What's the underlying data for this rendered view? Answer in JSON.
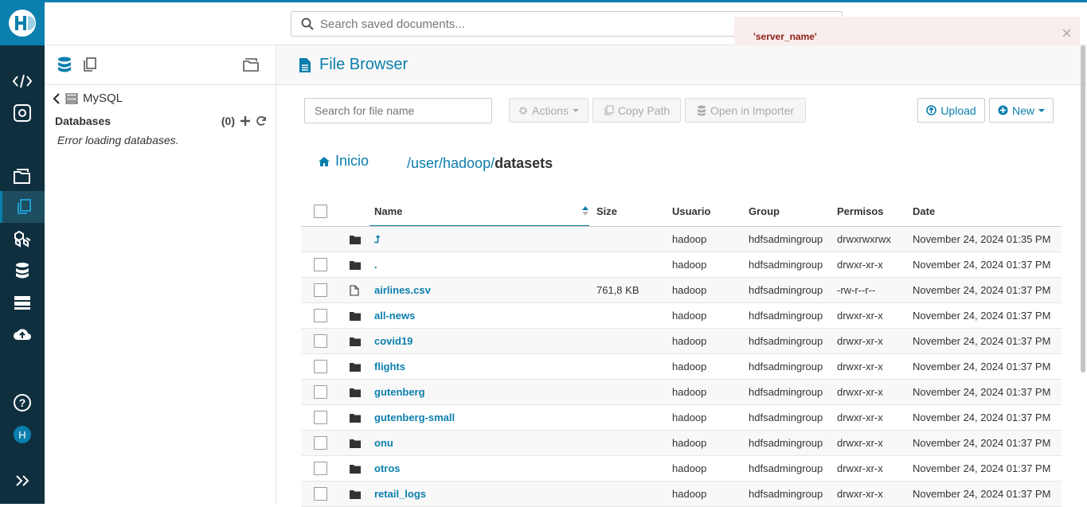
{
  "search": {
    "placeholder": "Search saved documents..."
  },
  "toast": {
    "message": "'server_name'",
    "close": "×"
  },
  "leftpanel": {
    "back_label": "MySQL",
    "databases_label": "Databases",
    "count": "(0)",
    "error": "Error loading databases."
  },
  "main": {
    "title": "File Browser",
    "filter_placeholder": "Search for file name",
    "actions_label": "Actions",
    "copy_label": "Copy Path",
    "importer_label": "Open in Importer",
    "upload_label": "Upload",
    "new_label": "New",
    "home_label": "Inicio",
    "path_prefix": "/user/hadoop/",
    "path_current": "datasets"
  },
  "table": {
    "headers": {
      "name": "Name",
      "size": "Size",
      "user": "Usuario",
      "group": "Group",
      "perms": "Permisos",
      "date": "Date"
    },
    "rows": [
      {
        "type": "folder",
        "name": "⮥",
        "size": "",
        "user": "hadoop",
        "group": "hdfsadmingroup",
        "perms": "drwxrwxrwx",
        "date": "November 24, 2024 01:35 PM",
        "checkbox": false
      },
      {
        "type": "folder",
        "name": ".",
        "size": "",
        "user": "hadoop",
        "group": "hdfsadmingroup",
        "perms": "drwxr-xr-x",
        "date": "November 24, 2024 01:37 PM",
        "checkbox": true
      },
      {
        "type": "file",
        "name": "airlines.csv",
        "size": "761,8 KB",
        "user": "hadoop",
        "group": "hdfsadmingroup",
        "perms": "-rw-r--r--",
        "date": "November 24, 2024 01:37 PM",
        "checkbox": true
      },
      {
        "type": "folder",
        "name": "all-news",
        "size": "",
        "user": "hadoop",
        "group": "hdfsadmingroup",
        "perms": "drwxr-xr-x",
        "date": "November 24, 2024 01:37 PM",
        "checkbox": true
      },
      {
        "type": "folder",
        "name": "covid19",
        "size": "",
        "user": "hadoop",
        "group": "hdfsadmingroup",
        "perms": "drwxr-xr-x",
        "date": "November 24, 2024 01:37 PM",
        "checkbox": true
      },
      {
        "type": "folder",
        "name": "flights",
        "size": "",
        "user": "hadoop",
        "group": "hdfsadmingroup",
        "perms": "drwxr-xr-x",
        "date": "November 24, 2024 01:37 PM",
        "checkbox": true
      },
      {
        "type": "folder",
        "name": "gutenberg",
        "size": "",
        "user": "hadoop",
        "group": "hdfsadmingroup",
        "perms": "drwxr-xr-x",
        "date": "November 24, 2024 01:37 PM",
        "checkbox": true
      },
      {
        "type": "folder",
        "name": "gutenberg-small",
        "size": "",
        "user": "hadoop",
        "group": "hdfsadmingroup",
        "perms": "drwxr-xr-x",
        "date": "November 24, 2024 01:37 PM",
        "checkbox": true
      },
      {
        "type": "folder",
        "name": "onu",
        "size": "",
        "user": "hadoop",
        "group": "hdfsadmingroup",
        "perms": "drwxr-xr-x",
        "date": "November 24, 2024 01:37 PM",
        "checkbox": true
      },
      {
        "type": "folder",
        "name": "otros",
        "size": "",
        "user": "hadoop",
        "group": "hdfsadmingroup",
        "perms": "drwxr-xr-x",
        "date": "November 24, 2024 01:37 PM",
        "checkbox": true
      },
      {
        "type": "folder",
        "name": "retail_logs",
        "size": "",
        "user": "hadoop",
        "group": "hdfsadmingroup",
        "perms": "drwxr-xr-x",
        "date": "November 24, 2024 01:37 PM",
        "checkbox": true
      }
    ]
  },
  "colors": {
    "accent": "#0b7fad",
    "nav_bg": "#0f2f3f",
    "toast_bg": "#f8eeed",
    "toast_text": "#901d15"
  }
}
